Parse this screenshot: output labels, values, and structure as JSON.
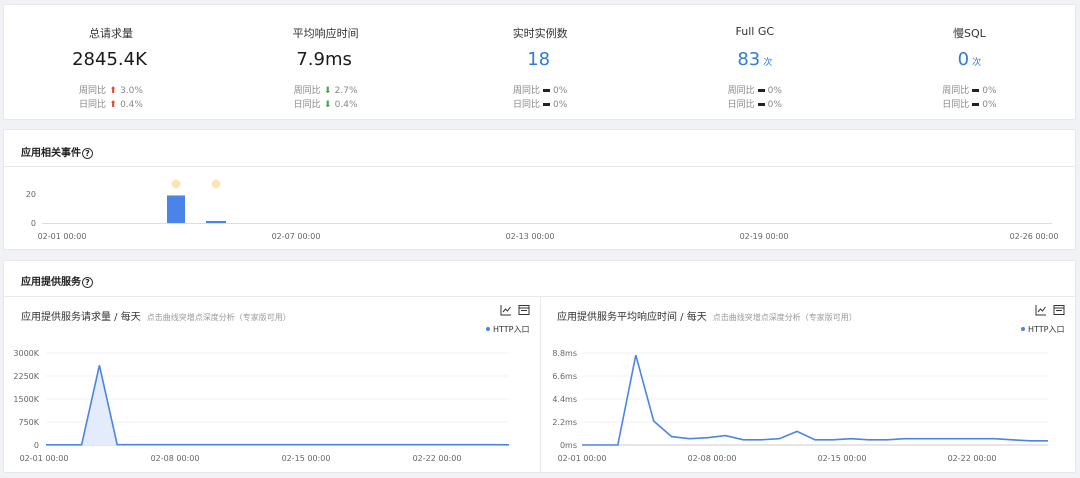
{
  "stats": [
    {
      "label": "总请求量",
      "value": "2845.4K",
      "unit": "",
      "color": "dark",
      "wow_label": "周同比",
      "wow_dir": "up",
      "wow_val": "3.0%",
      "dod_label": "日同比",
      "dod_dir": "up",
      "dod_val": "0.4%"
    },
    {
      "label": "平均响应时间",
      "value": "7.9ms",
      "unit": "",
      "color": "dark",
      "wow_label": "周同比",
      "wow_dir": "down",
      "wow_val": "2.7%",
      "dod_label": "日同比",
      "dod_dir": "down",
      "dod_val": "0.4%"
    },
    {
      "label": "实时实例数",
      "value": "18",
      "unit": "",
      "color": "blue",
      "wow_label": "周同比",
      "wow_dir": "flat",
      "wow_val": "0%",
      "dod_label": "日同比",
      "dod_dir": "flat",
      "dod_val": "0%"
    },
    {
      "label": "Full GC",
      "value": "83",
      "unit": "次",
      "color": "blue",
      "wow_label": "周同比",
      "wow_dir": "flat",
      "wow_val": "0%",
      "dod_label": "日同比",
      "dod_dir": "flat",
      "dod_val": "0%"
    },
    {
      "label": "慢SQL",
      "value": "0",
      "unit": "次",
      "color": "blue",
      "wow_label": "周同比",
      "wow_dir": "flat",
      "wow_val": "0%",
      "dod_label": "日同比",
      "dod_dir": "flat",
      "dod_val": "0%"
    }
  ],
  "events": {
    "title": "应用相关事件",
    "help_icon": "question-circle-icon"
  },
  "services": {
    "title": "应用提供服务",
    "help_icon": "question-circle-icon",
    "panels": [
      {
        "title": "应用提供服务请求量 / 每天",
        "hint": "点击曲线突增点深度分析（专家版可用）",
        "legend": "HTTP入口",
        "icons": [
          "line-chart-icon",
          "table-view-icon"
        ]
      },
      {
        "title": "应用提供服务平均响应时间 / 每天",
        "hint": "点击曲线突增点深度分析（专家版可用）",
        "legend": "HTTP入口",
        "icons": [
          "line-chart-icon",
          "table-view-icon"
        ]
      }
    ]
  },
  "colors": {
    "accent": "#4a84e8",
    "up": "#e8452c",
    "down": "#3aa845",
    "event_dot": "#fde3b8"
  },
  "chart_data": [
    {
      "type": "bar",
      "title": "",
      "x": [
        "02-01 00:00",
        "02-04",
        "02-05",
        "02-07 00:00",
        "02-13 00:00",
        "02-19 00:00",
        "02-26 00:00"
      ],
      "x_ticks": [
        "02-01 00:00",
        "02-07 00:00",
        "02-13 00:00",
        "02-19 00:00",
        "02-26 00:00"
      ],
      "y_ticks": [
        "0",
        "20"
      ],
      "bars": [
        {
          "x": "02-04",
          "value": 19
        },
        {
          "x": "02-05",
          "value": 1
        }
      ],
      "ylim": [
        0,
        20
      ],
      "grid": false
    },
    {
      "type": "area",
      "title": "应用提供服务请求量 / 每天",
      "x_ticks": [
        "02-01 00:00",
        "02-08 00:00",
        "02-15 00:00",
        "02-22 00:00"
      ],
      "y_ticks": [
        "0",
        "750K",
        "1500K",
        "2250K",
        "3000K"
      ],
      "ylim": [
        0,
        3000
      ],
      "series": [
        {
          "name": "HTTP入口",
          "values": [
            5,
            5,
            5,
            2600,
            10,
            10,
            10,
            10,
            10,
            10,
            10,
            10,
            10,
            10,
            10,
            10,
            10,
            10,
            10,
            10,
            10,
            10,
            10,
            10,
            10,
            10,
            5
          ]
        }
      ],
      "grid": true
    },
    {
      "type": "line",
      "title": "应用提供服务平均响应时间 / 每天",
      "x_ticks": [
        "02-01 00:00",
        "02-08 00:00",
        "02-15 00:00",
        "02-22 00:00"
      ],
      "y_ticks": [
        "0ms",
        "2.2ms",
        "4.4ms",
        "6.6ms",
        "8.8ms"
      ],
      "ylim": [
        0,
        8.8
      ],
      "series": [
        {
          "name": "HTTP入口",
          "values": [
            0,
            0,
            0,
            8.6,
            2.3,
            0.8,
            0.6,
            0.7,
            0.9,
            0.5,
            0.5,
            0.6,
            1.3,
            0.5,
            0.5,
            0.6,
            0.5,
            0.5,
            0.6,
            0.6,
            0.6,
            0.6,
            0.6,
            0.6,
            0.5,
            0.4,
            0.4
          ]
        }
      ],
      "grid": true
    }
  ]
}
